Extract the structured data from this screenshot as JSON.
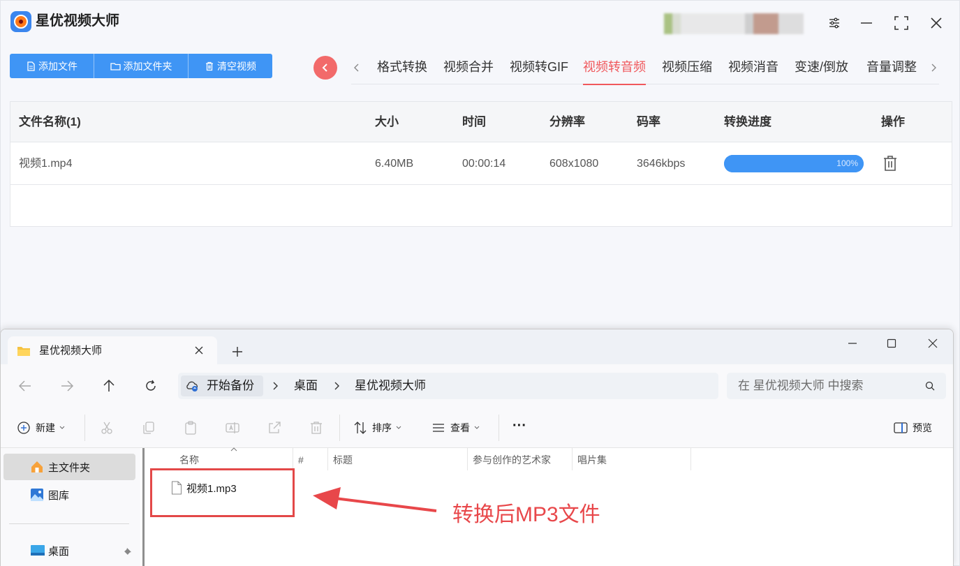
{
  "app": {
    "title": "星优视频大师",
    "toolbar": {
      "add_file": "添加文件",
      "add_folder": "添加文件夹",
      "clear": "清空视频"
    },
    "tabs": [
      {
        "label": "格式转换"
      },
      {
        "label": "视频合并"
      },
      {
        "label": "视频转GIF"
      },
      {
        "label": "视频转音频",
        "active": true
      },
      {
        "label": "视频压缩"
      },
      {
        "label": "视频消音"
      },
      {
        "label": "变速/倒放"
      },
      {
        "label": "音量调整"
      }
    ],
    "table": {
      "headers": {
        "name": "文件名称(1)",
        "size": "大小",
        "time": "时间",
        "resolution": "分辨率",
        "bitrate": "码率",
        "progress": "转换进度",
        "action": "操作"
      },
      "rows": [
        {
          "name": "视频1.mp4",
          "size": "6.40MB",
          "time": "00:00:14",
          "resolution": "608x1080",
          "bitrate": "3646kbps",
          "progress_label": "100%",
          "progress_value": 1.0
        }
      ]
    },
    "colors": {
      "accent": "#3f95f5",
      "active_tab": "#f0585c"
    }
  },
  "explorer": {
    "tab_title": "星优视频大师",
    "breadcrumb": [
      "开始备份",
      "桌面",
      "星优视频大师"
    ],
    "search_placeholder": "在 星优视频大师 中搜索",
    "commands": {
      "new": "新建",
      "sort": "排序",
      "view": "查看",
      "more": "···",
      "preview": "预览"
    },
    "nav": {
      "home": "主文件夹",
      "gallery": "图库",
      "desktop": "桌面"
    },
    "columns": {
      "name": "名称",
      "number": "#",
      "title": "标题",
      "artists": "参与创作的艺术家",
      "album": "唱片集"
    },
    "files": [
      {
        "name": "视频1.mp3"
      }
    ]
  },
  "annotation": {
    "text": "转换后MP3文件",
    "color": "#e8474a"
  }
}
